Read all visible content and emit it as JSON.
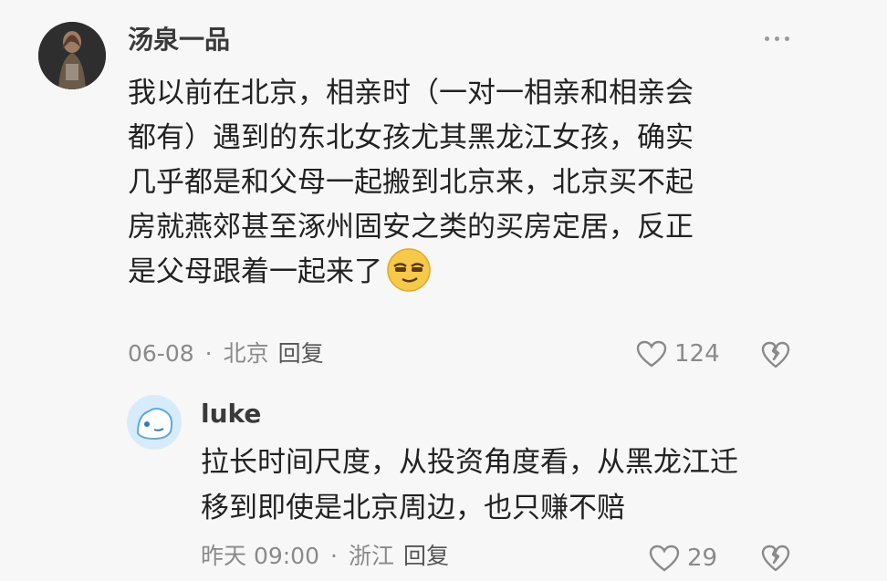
{
  "comments": [
    {
      "author": "汤泉一品",
      "lines": [
        "我以前在北京，相亲时（一对一相亲和相亲会",
        "都有）遇到的东北女孩尤其黑龙江女孩，确实",
        "几乎都是和父母一起搬到北京来，北京买不起",
        "房就燕郊甚至涿州固安之类的买房定居，反正",
        "是父母跟着一起来了"
      ],
      "emoji_icon": "smirk-emoji",
      "date": "06-08",
      "location": "北京",
      "reply_label": "回复",
      "likes": "124"
    }
  ],
  "replies": [
    {
      "author": "luke",
      "lines": [
        "拉长时间尺度，从投资角度看，从黑龙江迁",
        "移到即使是北京周边，也只赚不赔"
      ],
      "date": "昨天 09:00",
      "location": "浙江",
      "reply_label": "回复",
      "likes": "29"
    }
  ],
  "meta_separator": "·",
  "colors": {
    "background": "#f7f7f7",
    "meta_text": "#8a8a8a",
    "body_text": "#222222"
  }
}
